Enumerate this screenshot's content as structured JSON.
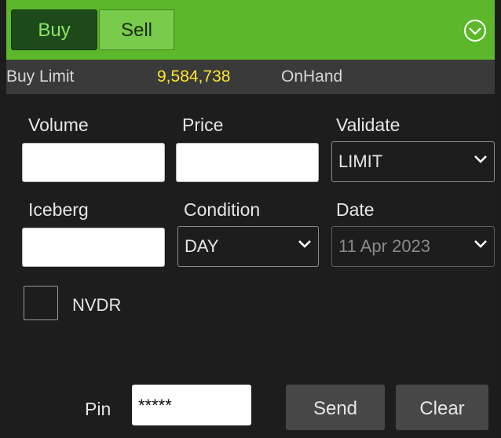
{
  "tabs": {
    "buy": "Buy",
    "sell": "Sell"
  },
  "info": {
    "buy_limit_label": "Buy Limit",
    "buy_limit_value": "9,584,738",
    "onhand_label": "OnHand"
  },
  "form": {
    "volume_label": "Volume",
    "price_label": "Price",
    "validate_label": "Validate",
    "validate_value": "LIMIT",
    "iceberg_label": "Iceberg",
    "condition_label": "Condition",
    "condition_value": "DAY",
    "date_label": "Date",
    "date_value": "11 Apr 2023",
    "nvdr_label": "NVDR"
  },
  "footer": {
    "pin_label": "Pin",
    "pin_value": "*****",
    "send_label": "Send",
    "clear_label": "Clear"
  },
  "colors": {
    "green": "#5cb82a",
    "dark_green": "#1d4a18",
    "highlight": "#ffe52e"
  },
  "icons": {
    "collapse": "chevron-down-circle-icon",
    "dropdown": "chevron-down-icon"
  }
}
